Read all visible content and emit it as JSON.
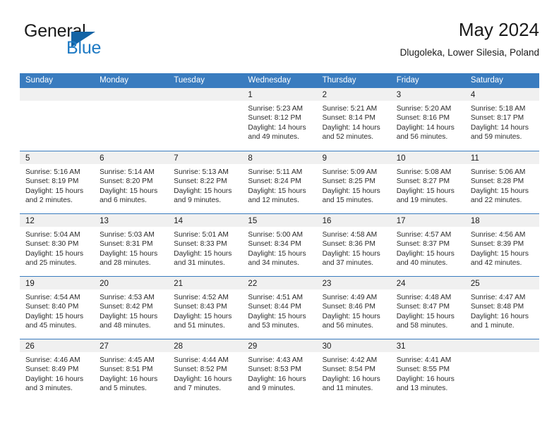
{
  "brand": {
    "name_line1": "General",
    "name_line2": "Blue",
    "logo_icon": "triangle-logo-icon"
  },
  "header": {
    "title": "May 2024",
    "subtitle": "Dlugoleka, Lower Silesia, Poland"
  },
  "colors": {
    "header_blue": "#3a7cbf",
    "brand_blue": "#1e7ac4",
    "logo_blue": "#1464a5",
    "daynum_band": "#f0f0f0",
    "text": "#1a1a1a"
  },
  "calendar": {
    "weekday_headers": [
      "Sunday",
      "Monday",
      "Tuesday",
      "Wednesday",
      "Thursday",
      "Friday",
      "Saturday"
    ],
    "weeks": [
      [
        {
          "day": "",
          "sunrise": "",
          "sunset": "",
          "daylight_line1": "",
          "daylight_line2": ""
        },
        {
          "day": "",
          "sunrise": "",
          "sunset": "",
          "daylight_line1": "",
          "daylight_line2": ""
        },
        {
          "day": "",
          "sunrise": "",
          "sunset": "",
          "daylight_line1": "",
          "daylight_line2": ""
        },
        {
          "day": "1",
          "sunrise": "Sunrise: 5:23 AM",
          "sunset": "Sunset: 8:12 PM",
          "daylight_line1": "Daylight: 14 hours",
          "daylight_line2": "and 49 minutes."
        },
        {
          "day": "2",
          "sunrise": "Sunrise: 5:21 AM",
          "sunset": "Sunset: 8:14 PM",
          "daylight_line1": "Daylight: 14 hours",
          "daylight_line2": "and 52 minutes."
        },
        {
          "day": "3",
          "sunrise": "Sunrise: 5:20 AM",
          "sunset": "Sunset: 8:16 PM",
          "daylight_line1": "Daylight: 14 hours",
          "daylight_line2": "and 56 minutes."
        },
        {
          "day": "4",
          "sunrise": "Sunrise: 5:18 AM",
          "sunset": "Sunset: 8:17 PM",
          "daylight_line1": "Daylight: 14 hours",
          "daylight_line2": "and 59 minutes."
        }
      ],
      [
        {
          "day": "5",
          "sunrise": "Sunrise: 5:16 AM",
          "sunset": "Sunset: 8:19 PM",
          "daylight_line1": "Daylight: 15 hours",
          "daylight_line2": "and 2 minutes."
        },
        {
          "day": "6",
          "sunrise": "Sunrise: 5:14 AM",
          "sunset": "Sunset: 8:20 PM",
          "daylight_line1": "Daylight: 15 hours",
          "daylight_line2": "and 6 minutes."
        },
        {
          "day": "7",
          "sunrise": "Sunrise: 5:13 AM",
          "sunset": "Sunset: 8:22 PM",
          "daylight_line1": "Daylight: 15 hours",
          "daylight_line2": "and 9 minutes."
        },
        {
          "day": "8",
          "sunrise": "Sunrise: 5:11 AM",
          "sunset": "Sunset: 8:24 PM",
          "daylight_line1": "Daylight: 15 hours",
          "daylight_line2": "and 12 minutes."
        },
        {
          "day": "9",
          "sunrise": "Sunrise: 5:09 AM",
          "sunset": "Sunset: 8:25 PM",
          "daylight_line1": "Daylight: 15 hours",
          "daylight_line2": "and 15 minutes."
        },
        {
          "day": "10",
          "sunrise": "Sunrise: 5:08 AM",
          "sunset": "Sunset: 8:27 PM",
          "daylight_line1": "Daylight: 15 hours",
          "daylight_line2": "and 19 minutes."
        },
        {
          "day": "11",
          "sunrise": "Sunrise: 5:06 AM",
          "sunset": "Sunset: 8:28 PM",
          "daylight_line1": "Daylight: 15 hours",
          "daylight_line2": "and 22 minutes."
        }
      ],
      [
        {
          "day": "12",
          "sunrise": "Sunrise: 5:04 AM",
          "sunset": "Sunset: 8:30 PM",
          "daylight_line1": "Daylight: 15 hours",
          "daylight_line2": "and 25 minutes."
        },
        {
          "day": "13",
          "sunrise": "Sunrise: 5:03 AM",
          "sunset": "Sunset: 8:31 PM",
          "daylight_line1": "Daylight: 15 hours",
          "daylight_line2": "and 28 minutes."
        },
        {
          "day": "14",
          "sunrise": "Sunrise: 5:01 AM",
          "sunset": "Sunset: 8:33 PM",
          "daylight_line1": "Daylight: 15 hours",
          "daylight_line2": "and 31 minutes."
        },
        {
          "day": "15",
          "sunrise": "Sunrise: 5:00 AM",
          "sunset": "Sunset: 8:34 PM",
          "daylight_line1": "Daylight: 15 hours",
          "daylight_line2": "and 34 minutes."
        },
        {
          "day": "16",
          "sunrise": "Sunrise: 4:58 AM",
          "sunset": "Sunset: 8:36 PM",
          "daylight_line1": "Daylight: 15 hours",
          "daylight_line2": "and 37 minutes."
        },
        {
          "day": "17",
          "sunrise": "Sunrise: 4:57 AM",
          "sunset": "Sunset: 8:37 PM",
          "daylight_line1": "Daylight: 15 hours",
          "daylight_line2": "and 40 minutes."
        },
        {
          "day": "18",
          "sunrise": "Sunrise: 4:56 AM",
          "sunset": "Sunset: 8:39 PM",
          "daylight_line1": "Daylight: 15 hours",
          "daylight_line2": "and 42 minutes."
        }
      ],
      [
        {
          "day": "19",
          "sunrise": "Sunrise: 4:54 AM",
          "sunset": "Sunset: 8:40 PM",
          "daylight_line1": "Daylight: 15 hours",
          "daylight_line2": "and 45 minutes."
        },
        {
          "day": "20",
          "sunrise": "Sunrise: 4:53 AM",
          "sunset": "Sunset: 8:42 PM",
          "daylight_line1": "Daylight: 15 hours",
          "daylight_line2": "and 48 minutes."
        },
        {
          "day": "21",
          "sunrise": "Sunrise: 4:52 AM",
          "sunset": "Sunset: 8:43 PM",
          "daylight_line1": "Daylight: 15 hours",
          "daylight_line2": "and 51 minutes."
        },
        {
          "day": "22",
          "sunrise": "Sunrise: 4:51 AM",
          "sunset": "Sunset: 8:44 PM",
          "daylight_line1": "Daylight: 15 hours",
          "daylight_line2": "and 53 minutes."
        },
        {
          "day": "23",
          "sunrise": "Sunrise: 4:49 AM",
          "sunset": "Sunset: 8:46 PM",
          "daylight_line1": "Daylight: 15 hours",
          "daylight_line2": "and 56 minutes."
        },
        {
          "day": "24",
          "sunrise": "Sunrise: 4:48 AM",
          "sunset": "Sunset: 8:47 PM",
          "daylight_line1": "Daylight: 15 hours",
          "daylight_line2": "and 58 minutes."
        },
        {
          "day": "25",
          "sunrise": "Sunrise: 4:47 AM",
          "sunset": "Sunset: 8:48 PM",
          "daylight_line1": "Daylight: 16 hours",
          "daylight_line2": "and 1 minute."
        }
      ],
      [
        {
          "day": "26",
          "sunrise": "Sunrise: 4:46 AM",
          "sunset": "Sunset: 8:49 PM",
          "daylight_line1": "Daylight: 16 hours",
          "daylight_line2": "and 3 minutes."
        },
        {
          "day": "27",
          "sunrise": "Sunrise: 4:45 AM",
          "sunset": "Sunset: 8:51 PM",
          "daylight_line1": "Daylight: 16 hours",
          "daylight_line2": "and 5 minutes."
        },
        {
          "day": "28",
          "sunrise": "Sunrise: 4:44 AM",
          "sunset": "Sunset: 8:52 PM",
          "daylight_line1": "Daylight: 16 hours",
          "daylight_line2": "and 7 minutes."
        },
        {
          "day": "29",
          "sunrise": "Sunrise: 4:43 AM",
          "sunset": "Sunset: 8:53 PM",
          "daylight_line1": "Daylight: 16 hours",
          "daylight_line2": "and 9 minutes."
        },
        {
          "day": "30",
          "sunrise": "Sunrise: 4:42 AM",
          "sunset": "Sunset: 8:54 PM",
          "daylight_line1": "Daylight: 16 hours",
          "daylight_line2": "and 11 minutes."
        },
        {
          "day": "31",
          "sunrise": "Sunrise: 4:41 AM",
          "sunset": "Sunset: 8:55 PM",
          "daylight_line1": "Daylight: 16 hours",
          "daylight_line2": "and 13 minutes."
        },
        {
          "day": "",
          "sunrise": "",
          "sunset": "",
          "daylight_line1": "",
          "daylight_line2": ""
        }
      ]
    ]
  }
}
